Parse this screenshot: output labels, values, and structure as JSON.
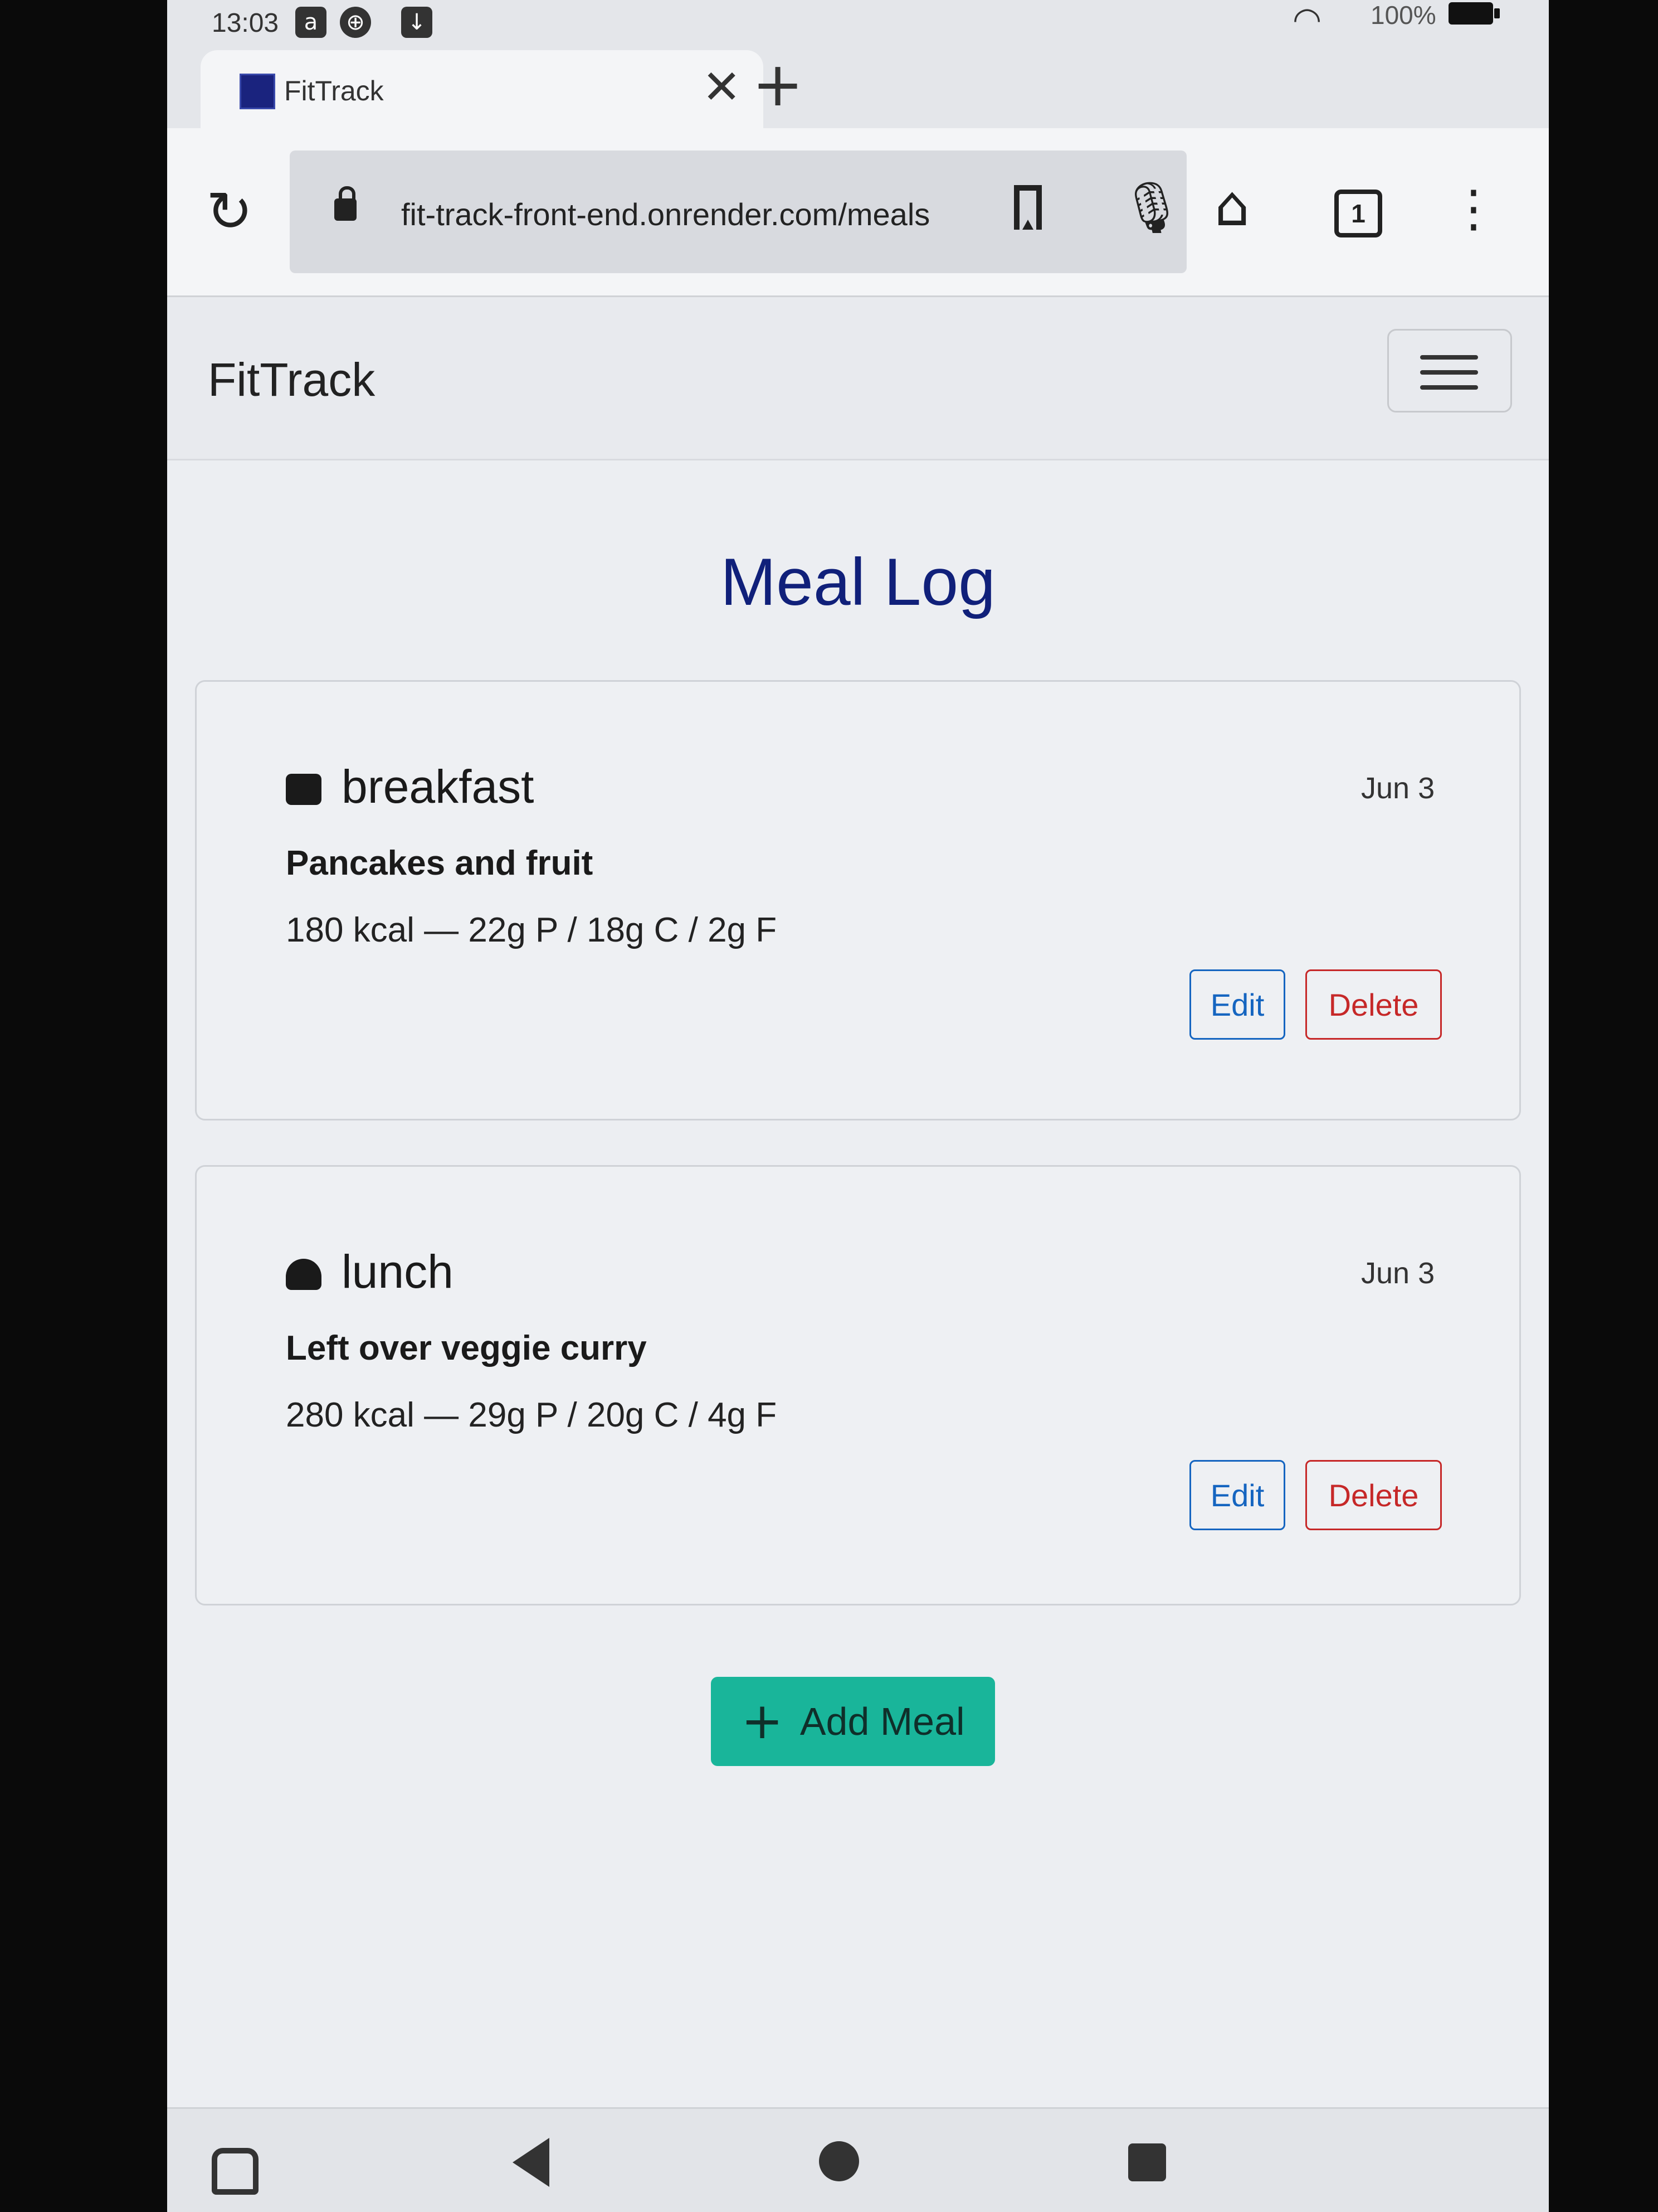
{
  "status": {
    "time": "13:03",
    "battery": "100%",
    "app_icons": [
      "a",
      "⊕",
      "↓"
    ]
  },
  "browser": {
    "tab_title": "FitTrack",
    "url": "fit-track-front-end.onrender.com/meals",
    "tab_count": "1"
  },
  "site": {
    "brand": "FitTrack"
  },
  "page": {
    "title": "Meal Log"
  },
  "meals": [
    {
      "type": "breakfast",
      "icon": "breakfast-icon",
      "date": "Jun 3",
      "name": "Pancakes and fruit",
      "macros": "180 kcal — 22g P / 18g C / 2g F",
      "edit_label": "Edit",
      "delete_label": "Delete"
    },
    {
      "type": "lunch",
      "icon": "burger-icon",
      "date": "Jun 3",
      "name": "Left over veggie curry",
      "macros": "280 kcal — 29g P / 20g C / 4g F",
      "edit_label": "Edit",
      "delete_label": "Delete"
    }
  ],
  "actions": {
    "add_meal": "Add Meal"
  },
  "colors": {
    "title": "#10207a",
    "primary": "#1565c0",
    "danger": "#c62828",
    "accent": "#19b59a"
  }
}
